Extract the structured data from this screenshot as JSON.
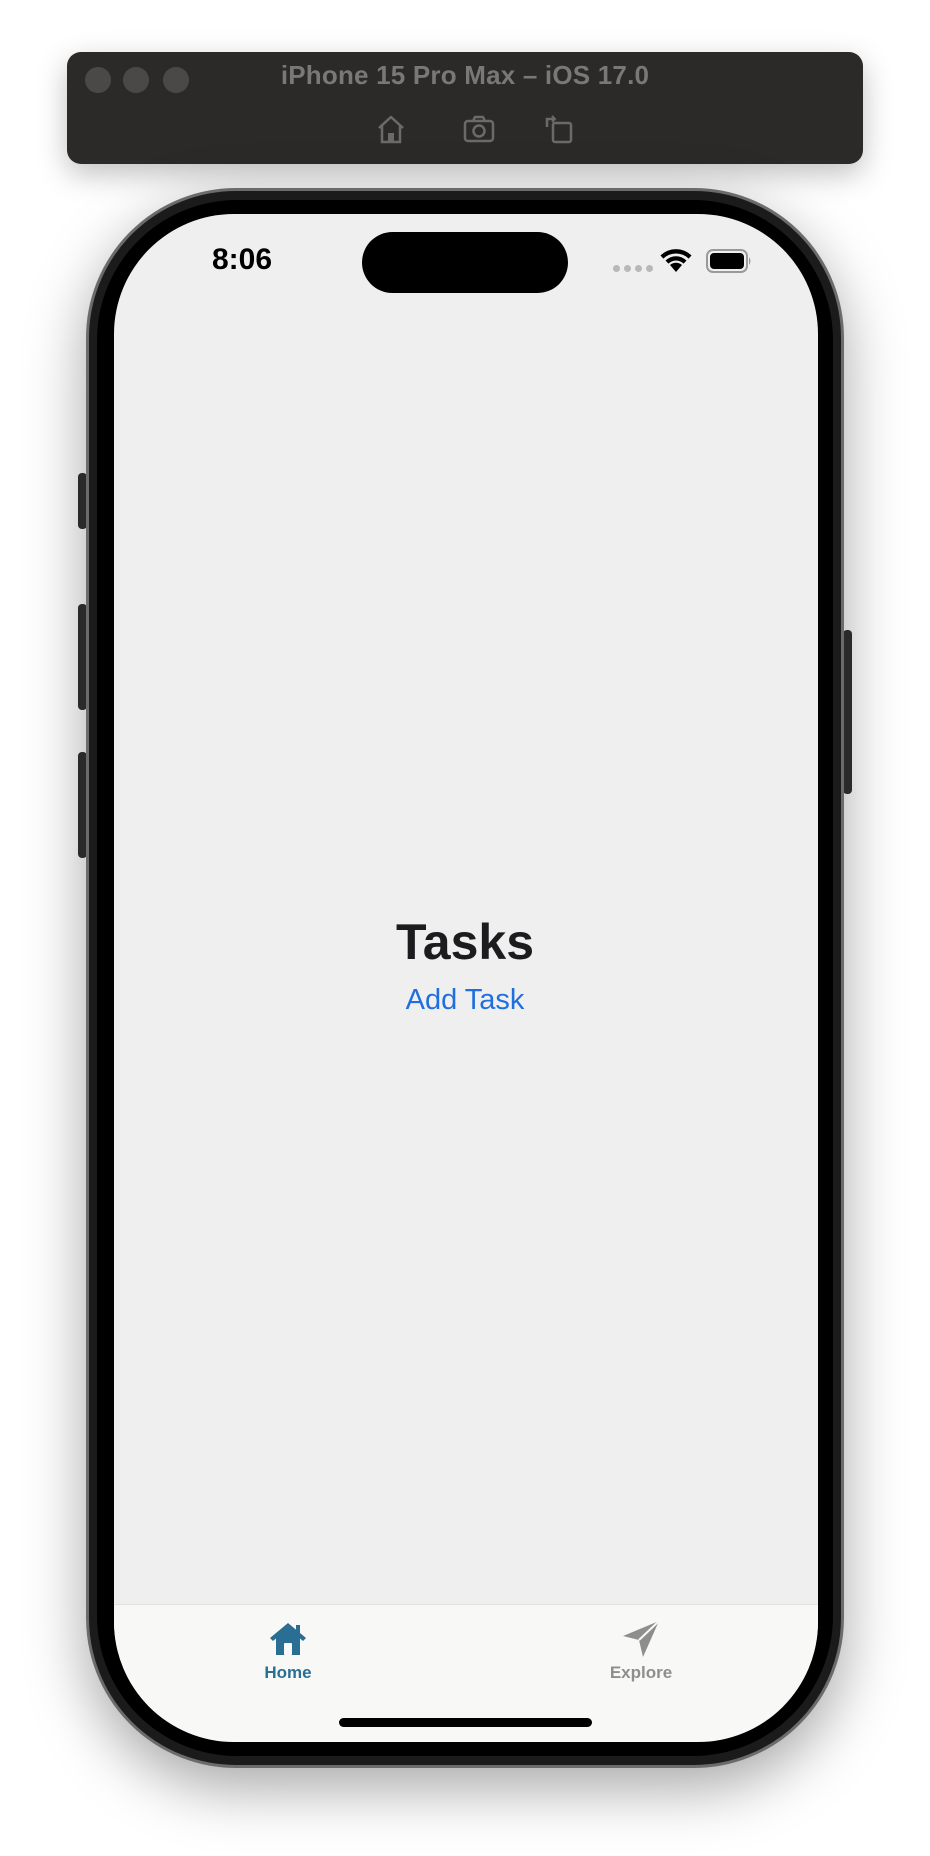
{
  "simulator": {
    "title": "iPhone 15 Pro Max – iOS 17.0",
    "tools": [
      "home-icon",
      "screenshot-icon",
      "rotate-icon"
    ]
  },
  "status_bar": {
    "time": "8:06"
  },
  "main": {
    "title": "Tasks",
    "add_task_label": "Add Task"
  },
  "tab_bar": {
    "tabs": [
      {
        "label": "Home",
        "icon": "home-icon",
        "selected": true
      },
      {
        "label": "Explore",
        "icon": "paper-plane-icon",
        "selected": false
      }
    ]
  },
  "colors": {
    "accent": "#1f6fde",
    "tab_selected": "#2a6f93",
    "tab_unselected": "#8e8e8e",
    "screen_background": "#efeff0"
  }
}
